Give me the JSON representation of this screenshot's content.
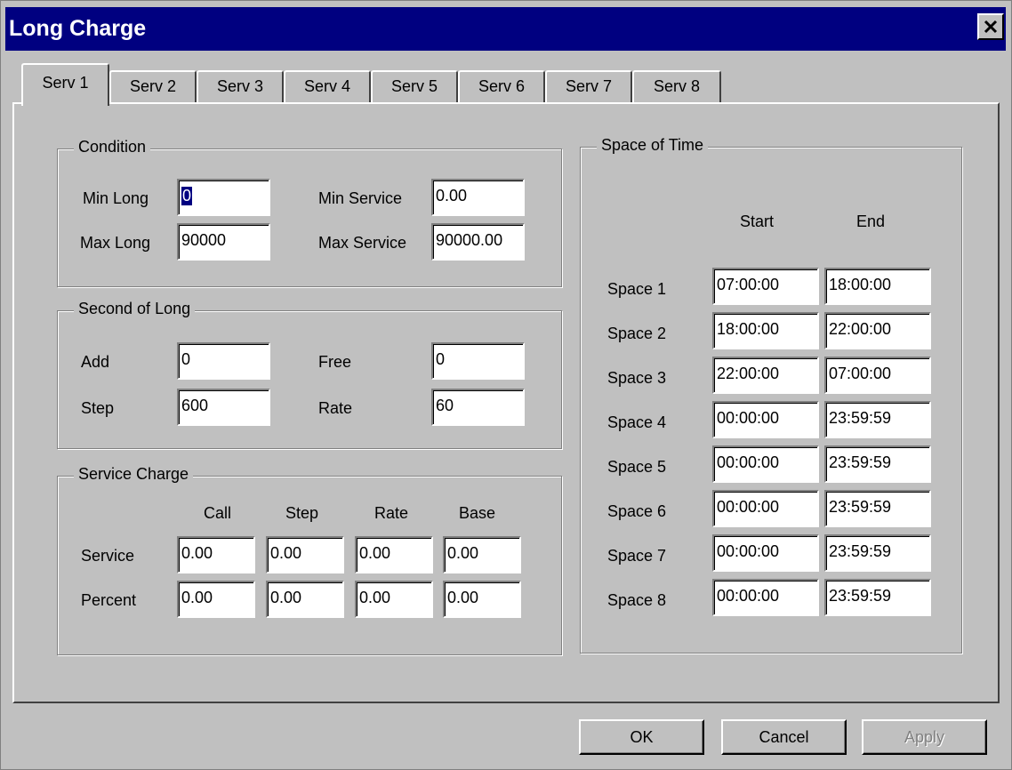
{
  "window": {
    "title": "Long Charge"
  },
  "tabs": [
    "Serv 1",
    "Serv 2",
    "Serv 3",
    "Serv 4",
    "Serv 5",
    "Serv 6",
    "Serv 7",
    "Serv 8"
  ],
  "active_tab": "Serv 1",
  "condition": {
    "legend": "Condition",
    "min_long_label": "Min Long",
    "min_long_value": "0",
    "max_long_label": "Max Long",
    "max_long_value": "90000",
    "min_service_label": "Min Service",
    "min_service_value": "0.00",
    "max_service_label": "Max Service",
    "max_service_value": "90000.00"
  },
  "second_of_long": {
    "legend": "Second of Long",
    "add_label": "Add",
    "add_value": "0",
    "step_label": "Step",
    "step_value": "600",
    "free_label": "Free",
    "free_value": "0",
    "rate_label": "Rate",
    "rate_value": "60"
  },
  "service_charge": {
    "legend": "Service Charge",
    "columns": [
      "Call",
      "Step",
      "Rate",
      "Base"
    ],
    "rows": [
      {
        "label": "Service",
        "values": [
          "0.00",
          "0.00",
          "0.00",
          "0.00"
        ]
      },
      {
        "label": "Percent",
        "values": [
          "0.00",
          "0.00",
          "0.00",
          "0.00"
        ]
      }
    ]
  },
  "space_of_time": {
    "legend": "Space of Time",
    "start_header": "Start",
    "end_header": "End",
    "rows": [
      {
        "label": "Space 1",
        "start": "07:00:00",
        "end": "18:00:00"
      },
      {
        "label": "Space 2",
        "start": "18:00:00",
        "end": "22:00:00"
      },
      {
        "label": "Space 3",
        "start": "22:00:00",
        "end": "07:00:00"
      },
      {
        "label": "Space 4",
        "start": "00:00:00",
        "end": "23:59:59"
      },
      {
        "label": "Space 5",
        "start": "00:00:00",
        "end": "23:59:59"
      },
      {
        "label": "Space 6",
        "start": "00:00:00",
        "end": "23:59:59"
      },
      {
        "label": "Space 7",
        "start": "00:00:00",
        "end": "23:59:59"
      },
      {
        "label": "Space 8",
        "start": "00:00:00",
        "end": "23:59:59"
      }
    ]
  },
  "buttons": {
    "ok": "OK",
    "cancel": "Cancel",
    "apply": "Apply"
  },
  "colors": {
    "titlebar": "#000080",
    "face": "#c0c0c0",
    "selection": "#000080"
  },
  "icons": {
    "close": "close-icon"
  }
}
